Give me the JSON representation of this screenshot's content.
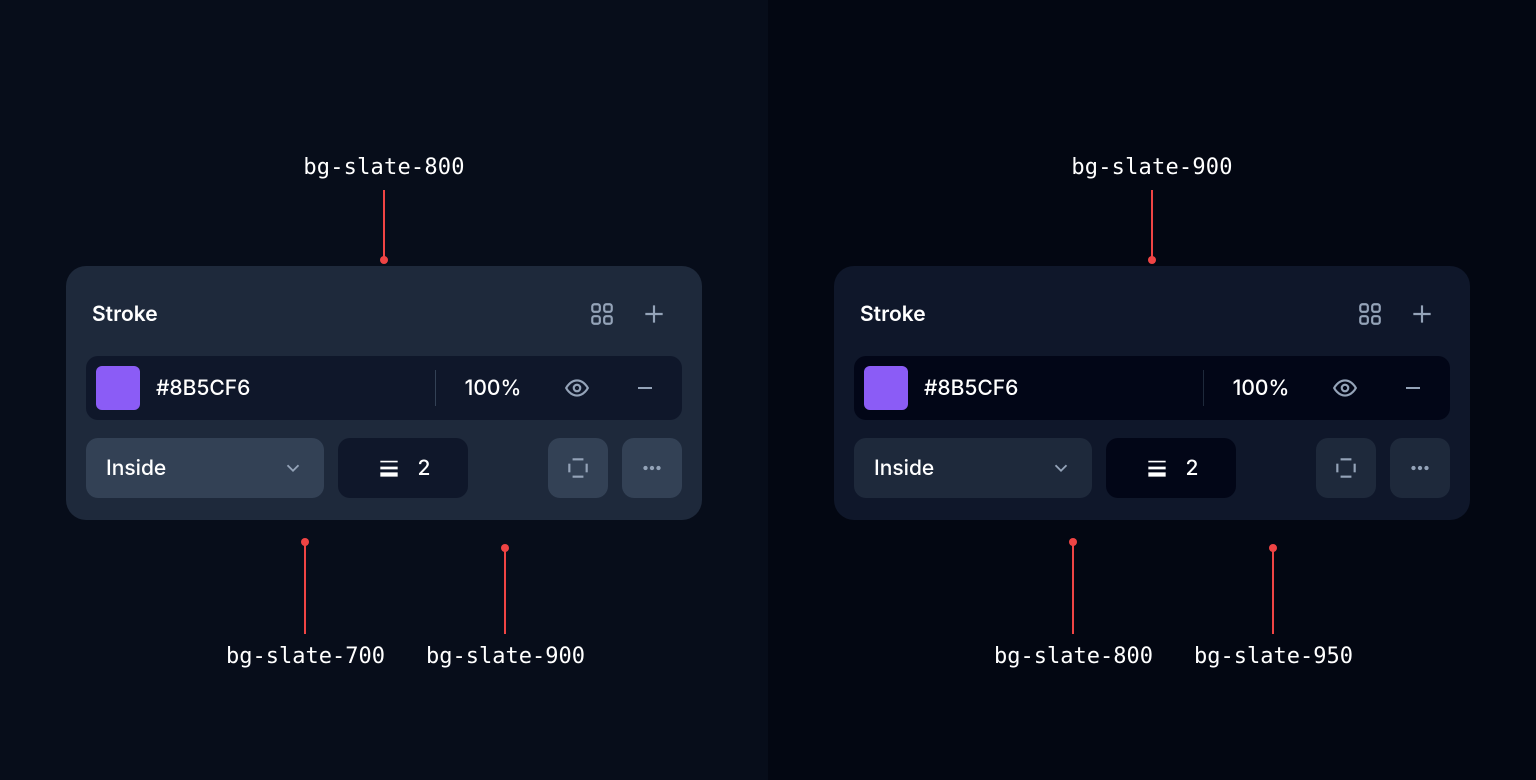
{
  "left": {
    "top_label": "bg-slate-800",
    "panel": {
      "title": "Stroke",
      "color_hex": "#8B5CF6",
      "opacity": "100%",
      "position": "Inside",
      "stroke_width": "2",
      "swatch_color": "#8b5cf6"
    },
    "bottom_labels": {
      "select": "bg-slate-700",
      "width": "bg-slate-900"
    }
  },
  "right": {
    "top_label": "bg-slate-900",
    "panel": {
      "title": "Stroke",
      "color_hex": "#8B5CF6",
      "opacity": "100%",
      "position": "Inside",
      "stroke_width": "2",
      "swatch_color": "#8b5cf6"
    },
    "bottom_labels": {
      "select": "bg-slate-800",
      "width": "bg-slate-950"
    }
  }
}
